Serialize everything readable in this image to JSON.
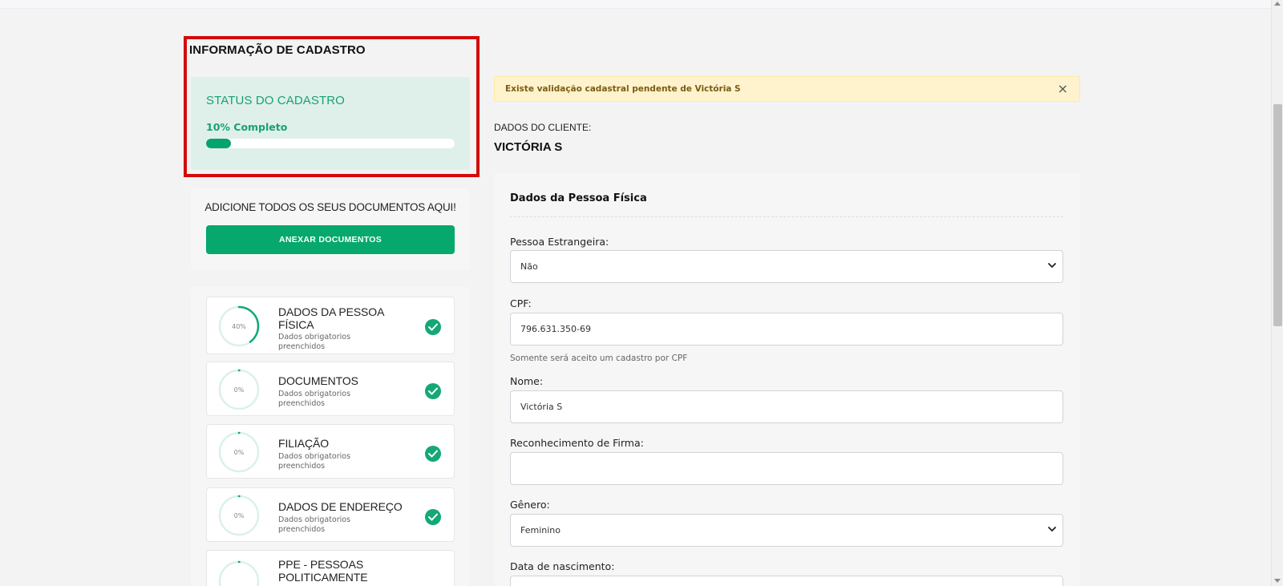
{
  "registration": {
    "section_title": "INFORMAÇÃO DE CADASTRO",
    "status_title": "STATUS DO CADASTRO",
    "progress_percent": 10,
    "progress_text": "10% Completo"
  },
  "documents": {
    "prompt": "ADICIONE TODOS OS SEUS DOCUMENTOS AQUI!",
    "button_label": "ANEXAR DOCUMENTOS"
  },
  "steps": [
    {
      "title": "DADOS DA PESSOA FÍSICA",
      "title_lines": [
        "DADOS DA PESSOA",
        "FÍSICA"
      ],
      "percent_label": "40%",
      "percent": 40,
      "subtitle_lines": [
        "Dados obrigatorios",
        "preenchidos"
      ],
      "complete": true
    },
    {
      "title": "DOCUMENTOS",
      "title_lines": [
        "DOCUMENTOS"
      ],
      "percent_label": "0%",
      "percent": 0,
      "subtitle_lines": [
        "Dados obrigatorios",
        "preenchidos"
      ],
      "complete": true
    },
    {
      "title": "FILIAÇÃO",
      "title_lines": [
        "FILIAÇÃO"
      ],
      "percent_label": "0%",
      "percent": 0,
      "subtitle_lines": [
        "Dados obrigatorios",
        "preenchidos"
      ],
      "complete": true
    },
    {
      "title": "DADOS DE ENDEREÇO",
      "title_lines": [
        "DADOS DE ENDEREÇO"
      ],
      "percent_label": "0%",
      "percent": 0,
      "subtitle_lines": [
        "Dados obrigatorios",
        "preenchidos"
      ],
      "complete": true
    },
    {
      "title": "PPE - PESSOAS POLITICAMENTE",
      "title_lines": [
        "PPE - PESSOAS",
        "POLITICAMENTE"
      ],
      "percent_label": "",
      "percent": 0,
      "subtitle_lines": [],
      "complete": false
    }
  ],
  "alert": {
    "message": "Existe validação cadastral pendente de Victória S",
    "close_symbol": "×"
  },
  "client": {
    "label": "DADOS DO CLIENTE:",
    "name": "VICTÓRIA S"
  },
  "form": {
    "heading": "Dados da Pessoa Física",
    "foreign_label": "Pessoa Estrangeira:",
    "foreign_value": "Não",
    "cpf_label": "CPF:",
    "cpf_value": "796.631.350-69",
    "cpf_help": "Somente será aceito um cadastro por CPF",
    "name_label": "Nome:",
    "name_value": "Victória S",
    "signature_label": "Reconhecimento de Firma:",
    "signature_value": "",
    "gender_label": "Gênero:",
    "gender_value": "Feminino",
    "birth_label": "Data de nascimento:"
  },
  "colors": {
    "brand_green": "#06a86e",
    "status_bg": "#dff0ea",
    "highlight_red": "#d50a0a",
    "alert_bg": "#fff3cd"
  }
}
